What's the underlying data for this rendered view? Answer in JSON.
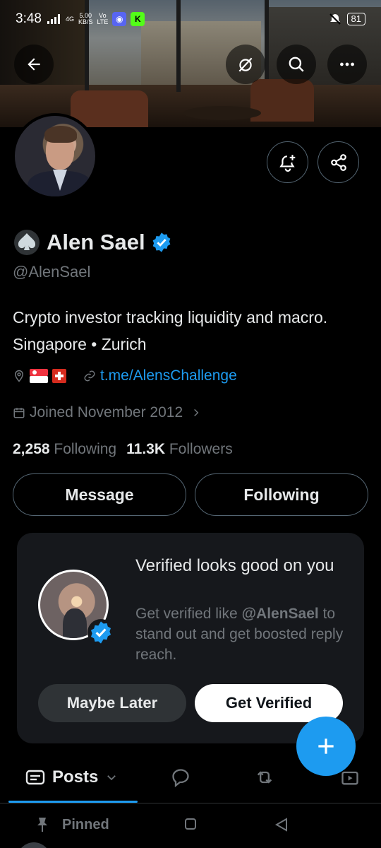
{
  "status_bar": {
    "time": "3:48",
    "net_top": "4G",
    "speed_top": "5.00",
    "speed_unit": "KB/S",
    "volte_top": "Vo",
    "volte_bottom": "LTE",
    "battery": "81"
  },
  "profile": {
    "name": "Alen Sael",
    "handle": "@AlenSael",
    "bio_line1": "Crypto investor tracking liquidity and macro.",
    "bio_line2": "Singapore • Zurich",
    "link": "t.me/AlensChallenge",
    "joined": "Joined November 2012",
    "following_count": "2,258",
    "following_label": "Following",
    "followers_count": "11.3K",
    "followers_label": "Followers"
  },
  "actions": {
    "message": "Message",
    "following": "Following"
  },
  "verified_card": {
    "title": "Verified looks good on you",
    "sub_prefix": "Get verified like ",
    "sub_handle": "@AlenSael",
    "sub_suffix": " to stand out and get boosted reply reach.",
    "maybe_later": "Maybe Later",
    "get_verified": "Get Verified"
  },
  "tabs": {
    "posts": "Posts"
  },
  "pinned_label": "Pinned",
  "colors": {
    "accent": "#1d9bf0",
    "background": "#000000",
    "muted": "#71767b",
    "card": "#16181c"
  },
  "icons": [
    "back-arrow-icon",
    "unmute-icon",
    "search-icon",
    "more-icon",
    "bell-plus-icon",
    "share-icon",
    "spade-icon",
    "verified-badge-icon",
    "location-icon",
    "singapore-flag-icon",
    "swiss-flag-icon",
    "link-icon",
    "calendar-icon",
    "chevron-right-icon",
    "plus-icon",
    "posts-tab-icon",
    "replies-icon",
    "reposts-icon",
    "media-icon",
    "pin-icon"
  ]
}
